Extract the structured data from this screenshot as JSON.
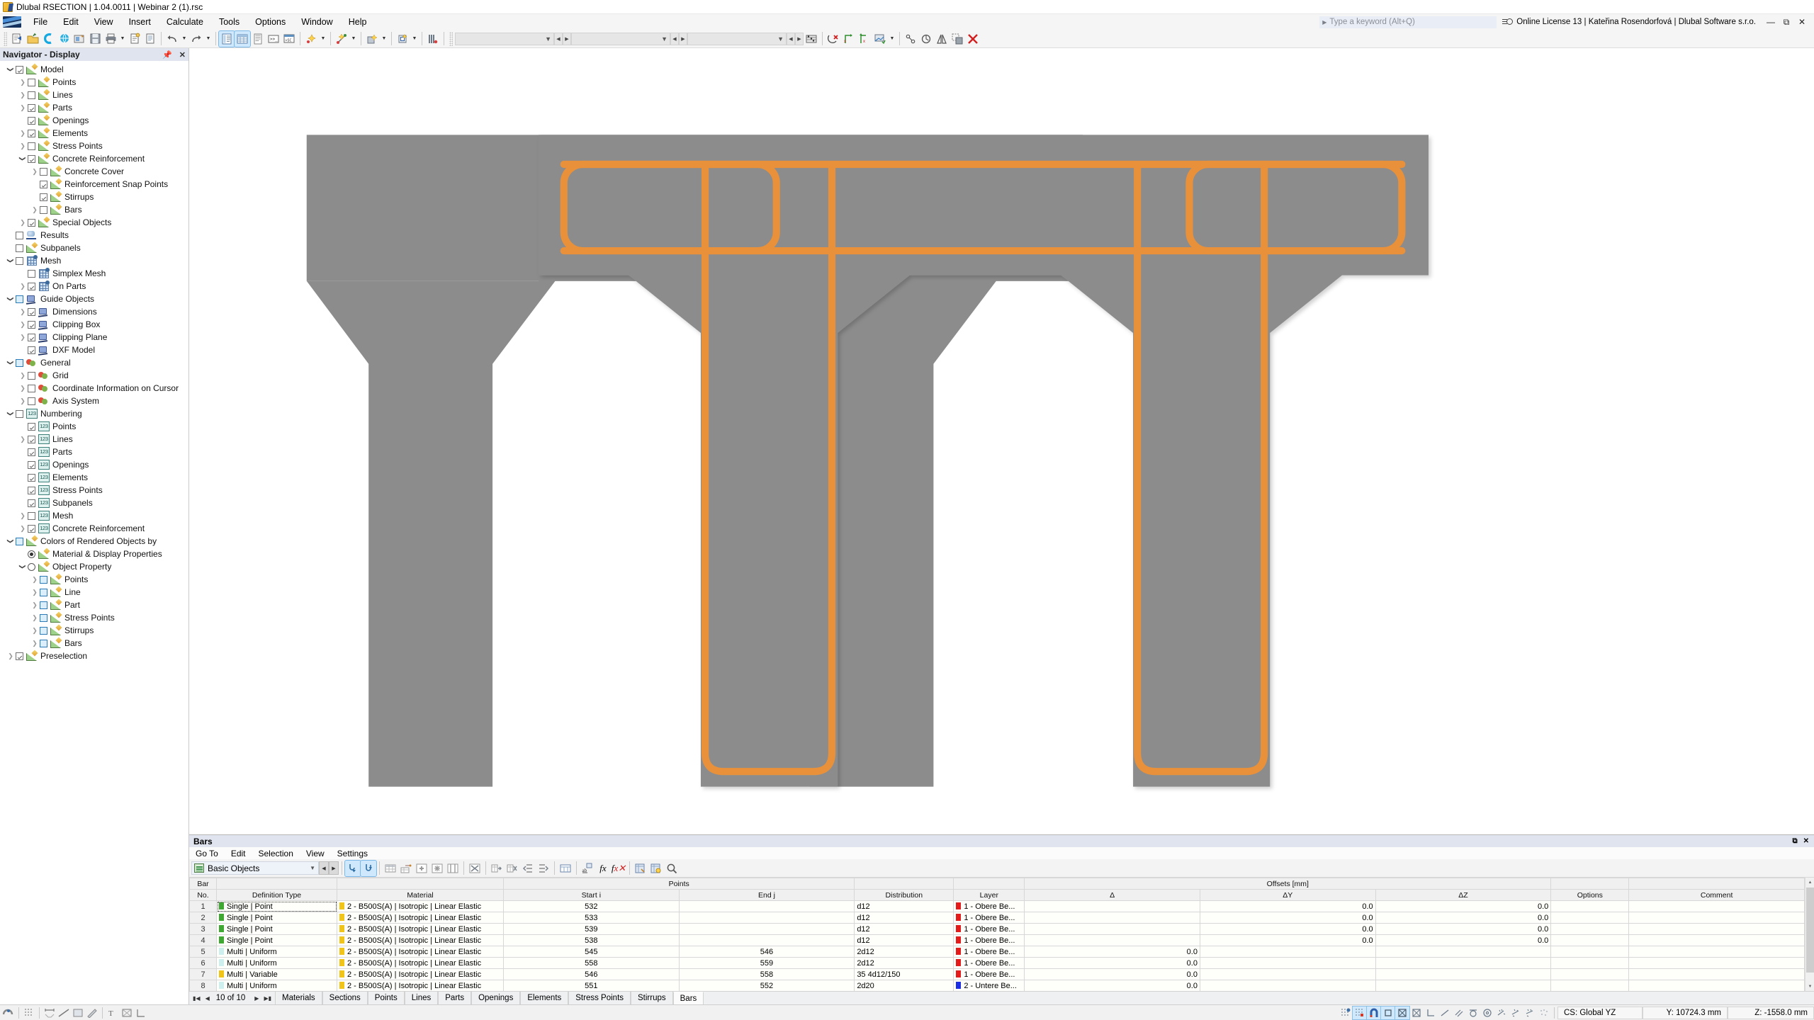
{
  "titlebar": {
    "title": "Dlubal RSECTION | 1.04.0011 | Webinar 2 (1).rsc",
    "icon": "dlubal-logo-icon"
  },
  "menubar": {
    "items": [
      "File",
      "Edit",
      "View",
      "Insert",
      "Calculate",
      "Tools",
      "Options",
      "Window",
      "Help"
    ],
    "search_placeholder": "Type a keyword (Alt+Q)",
    "license": "Online License 13 | Kateřina Rosendorfová | Dlubal Software s.r.o.",
    "window_buttons": [
      "minimize",
      "restore",
      "close"
    ]
  },
  "navigator": {
    "title": "Navigator - Display",
    "pin_icon": "pin-icon",
    "close_icon": "close-icon",
    "items": [
      {
        "label": "Model",
        "indent": 0,
        "expander": "down",
        "check": "checked",
        "icon": "ruler-icon"
      },
      {
        "label": "Points",
        "indent": 1,
        "expander": "right",
        "check": "unchecked",
        "icon": "ruler-icon"
      },
      {
        "label": "Lines",
        "indent": 1,
        "expander": "right",
        "check": "unchecked",
        "icon": "ruler-icon"
      },
      {
        "label": "Parts",
        "indent": 1,
        "expander": "right",
        "check": "checked",
        "icon": "ruler-icon"
      },
      {
        "label": "Openings",
        "indent": 1,
        "expander": "none",
        "check": "checked",
        "icon": "ruler-icon"
      },
      {
        "label": "Elements",
        "indent": 1,
        "expander": "right",
        "check": "checked",
        "icon": "ruler-icon"
      },
      {
        "label": "Stress Points",
        "indent": 1,
        "expander": "right",
        "check": "unchecked",
        "icon": "ruler-icon"
      },
      {
        "label": "Concrete Reinforcement",
        "indent": 1,
        "expander": "down",
        "check": "checked",
        "icon": "ruler-icon"
      },
      {
        "label": "Concrete Cover",
        "indent": 2,
        "expander": "right",
        "check": "unchecked",
        "icon": "ruler-icon"
      },
      {
        "label": "Reinforcement Snap Points",
        "indent": 2,
        "expander": "none",
        "check": "checked",
        "icon": "ruler-icon"
      },
      {
        "label": "Stirrups",
        "indent": 2,
        "expander": "none",
        "check": "checked",
        "icon": "ruler-icon"
      },
      {
        "label": "Bars",
        "indent": 2,
        "expander": "right",
        "check": "unchecked",
        "icon": "ruler-icon"
      },
      {
        "label": "Special Objects",
        "indent": 1,
        "expander": "right",
        "check": "checked",
        "icon": "ruler-icon"
      },
      {
        "label": "Results",
        "indent": 0,
        "expander": "none",
        "check": "unchecked",
        "icon": "results-icon"
      },
      {
        "label": "Subpanels",
        "indent": 0,
        "expander": "none",
        "check": "unchecked",
        "icon": "ruler-icon"
      },
      {
        "label": "Mesh",
        "indent": 0,
        "expander": "down",
        "check": "unchecked",
        "icon": "mesh-icon"
      },
      {
        "label": "Simplex Mesh",
        "indent": 1,
        "expander": "none",
        "check": "unchecked",
        "icon": "mesh-icon"
      },
      {
        "label": "On Parts",
        "indent": 1,
        "expander": "right",
        "check": "checked",
        "icon": "mesh-icon"
      },
      {
        "label": "Guide Objects",
        "indent": 0,
        "expander": "down",
        "check": "blue",
        "icon": "guide-icon"
      },
      {
        "label": "Dimensions",
        "indent": 1,
        "expander": "right",
        "check": "checked",
        "icon": "guide-icon"
      },
      {
        "label": "Clipping Box",
        "indent": 1,
        "expander": "right",
        "check": "checked",
        "icon": "guide-icon"
      },
      {
        "label": "Clipping Plane",
        "indent": 1,
        "expander": "right",
        "check": "checked",
        "icon": "guide-icon"
      },
      {
        "label": "DXF Model",
        "indent": 1,
        "expander": "none",
        "check": "checked",
        "icon": "guide-icon"
      },
      {
        "label": "General",
        "indent": 0,
        "expander": "down",
        "check": "blue",
        "icon": "general-icon"
      },
      {
        "label": "Grid",
        "indent": 1,
        "expander": "right",
        "check": "unchecked",
        "icon": "general-icon"
      },
      {
        "label": "Coordinate Information on Cursor",
        "indent": 1,
        "expander": "right",
        "check": "unchecked",
        "icon": "general-icon"
      },
      {
        "label": "Axis System",
        "indent": 1,
        "expander": "right",
        "check": "unchecked",
        "icon": "general-icon"
      },
      {
        "label": "Numbering",
        "indent": 0,
        "expander": "down",
        "check": "unchecked",
        "icon": "numbering-icon"
      },
      {
        "label": "Points",
        "indent": 1,
        "expander": "none",
        "check": "checked",
        "icon": "numbering-icon"
      },
      {
        "label": "Lines",
        "indent": 1,
        "expander": "right",
        "check": "checked",
        "icon": "numbering-icon"
      },
      {
        "label": "Parts",
        "indent": 1,
        "expander": "none",
        "check": "checked",
        "icon": "numbering-icon"
      },
      {
        "label": "Openings",
        "indent": 1,
        "expander": "none",
        "check": "checked",
        "icon": "numbering-icon"
      },
      {
        "label": "Elements",
        "indent": 1,
        "expander": "none",
        "check": "checked",
        "icon": "numbering-icon"
      },
      {
        "label": "Stress Points",
        "indent": 1,
        "expander": "none",
        "check": "checked",
        "icon": "numbering-icon"
      },
      {
        "label": "Subpanels",
        "indent": 1,
        "expander": "none",
        "check": "checked",
        "icon": "numbering-icon"
      },
      {
        "label": "Mesh",
        "indent": 1,
        "expander": "right",
        "check": "unchecked",
        "icon": "numbering-icon"
      },
      {
        "label": "Concrete Reinforcement",
        "indent": 1,
        "expander": "right",
        "check": "checked",
        "icon": "numbering-icon"
      },
      {
        "label": "Colors of Rendered Objects by",
        "indent": 0,
        "expander": "down",
        "check": "blue",
        "icon": "ruler-icon"
      },
      {
        "label": "Material & Display Properties",
        "indent": 1,
        "expander": "none",
        "check": "radio-selected",
        "icon": "ruler-icon"
      },
      {
        "label": "Object Property",
        "indent": 1,
        "expander": "down",
        "check": "radio",
        "icon": "ruler-icon"
      },
      {
        "label": "Points",
        "indent": 2,
        "expander": "right",
        "check": "blue",
        "icon": "ruler-icon"
      },
      {
        "label": "Line",
        "indent": 2,
        "expander": "right",
        "check": "blue",
        "icon": "ruler-icon"
      },
      {
        "label": "Part",
        "indent": 2,
        "expander": "right",
        "check": "blue",
        "icon": "ruler-icon"
      },
      {
        "label": "Stress Points",
        "indent": 2,
        "expander": "right",
        "check": "blue",
        "icon": "ruler-icon"
      },
      {
        "label": "Stirrups",
        "indent": 2,
        "expander": "right",
        "check": "blue",
        "icon": "ruler-icon"
      },
      {
        "label": "Bars",
        "indent": 2,
        "expander": "right",
        "check": "blue",
        "icon": "ruler-icon"
      },
      {
        "label": "Preselection",
        "indent": 0,
        "expander": "right",
        "check": "checked",
        "icon": "ruler-icon"
      }
    ]
  },
  "viewport": {
    "concrete_color": "#8c8c8c",
    "rebar_color": "#e8913a",
    "background": "#ffffff"
  },
  "table_panel": {
    "title": "Bars",
    "menu": [
      "Go To",
      "Edit",
      "Selection",
      "View",
      "Settings"
    ],
    "object_filter": "Basic Objects",
    "headers_top": {
      "points": "Points",
      "offsets": "Offsets [mm]"
    },
    "columns": [
      "Bar No.",
      "Definition Type",
      "Material",
      "Start i",
      "End j",
      "Distribution",
      "Layer",
      "Δ",
      "ΔY",
      "ΔZ",
      "Options",
      "Comment"
    ],
    "rows": [
      {
        "no": "1",
        "def_type": "Single | Point",
        "def_color": "#3ea832",
        "material": "2 - B500S(A) | Isotropic | Linear Elastic",
        "mat_color": "#f0c419",
        "start": "532",
        "end": "",
        "distribution": "d12",
        "layer": "1 - Obere Be...",
        "layer_color": "#e31b1b",
        "delta": "",
        "dy": "0.0",
        "dz": "0.0",
        "options": "",
        "comment": ""
      },
      {
        "no": "2",
        "def_type": "Single | Point",
        "def_color": "#3ea832",
        "material": "2 - B500S(A) | Isotropic | Linear Elastic",
        "mat_color": "#f0c419",
        "start": "533",
        "end": "",
        "distribution": "d12",
        "layer": "1 - Obere Be...",
        "layer_color": "#e31b1b",
        "delta": "",
        "dy": "0.0",
        "dz": "0.0",
        "options": "",
        "comment": ""
      },
      {
        "no": "3",
        "def_type": "Single | Point",
        "def_color": "#3ea832",
        "material": "2 - B500S(A) | Isotropic | Linear Elastic",
        "mat_color": "#f0c419",
        "start": "539",
        "end": "",
        "distribution": "d12",
        "layer": "1 - Obere Be...",
        "layer_color": "#e31b1b",
        "delta": "",
        "dy": "0.0",
        "dz": "0.0",
        "options": "",
        "comment": ""
      },
      {
        "no": "4",
        "def_type": "Single | Point",
        "def_color": "#3ea832",
        "material": "2 - B500S(A) | Isotropic | Linear Elastic",
        "mat_color": "#f0c419",
        "start": "538",
        "end": "",
        "distribution": "d12",
        "layer": "1 - Obere Be...",
        "layer_color": "#e31b1b",
        "delta": "",
        "dy": "0.0",
        "dz": "0.0",
        "options": "",
        "comment": ""
      },
      {
        "no": "5",
        "def_type": "Multi | Uniform",
        "def_color": "#cdf0ee",
        "material": "2 - B500S(A) | Isotropic | Linear Elastic",
        "mat_color": "#f0c419",
        "start": "545",
        "end": "546",
        "distribution": "2d12",
        "layer": "1 - Obere Be...",
        "layer_color": "#e31b1b",
        "delta": "0.0",
        "dy": "",
        "dz": "",
        "options": "",
        "comment": ""
      },
      {
        "no": "6",
        "def_type": "Multi | Uniform",
        "def_color": "#cdf0ee",
        "material": "2 - B500S(A) | Isotropic | Linear Elastic",
        "mat_color": "#f0c419",
        "start": "558",
        "end": "559",
        "distribution": "2d12",
        "layer": "1 - Obere Be...",
        "layer_color": "#e31b1b",
        "delta": "0.0",
        "dy": "",
        "dz": "",
        "options": "",
        "comment": ""
      },
      {
        "no": "7",
        "def_type": "Multi | Variable",
        "def_color": "#f0c419",
        "material": "2 - B500S(A) | Isotropic | Linear Elastic",
        "mat_color": "#f0c419",
        "start": "546",
        "end": "558",
        "distribution": "35 4d12/150",
        "layer": "1 - Obere Be...",
        "layer_color": "#e31b1b",
        "delta": "0.0",
        "dy": "",
        "dz": "",
        "options": "",
        "comment": ""
      },
      {
        "no": "8",
        "def_type": "Multi | Uniform",
        "def_color": "#cdf0ee",
        "material": "2 - B500S(A) | Isotropic | Linear Elastic",
        "mat_color": "#f0c419",
        "start": "551",
        "end": "552",
        "distribution": "2d20",
        "layer": "2 - Untere Be...",
        "layer_color": "#1b2ee3",
        "delta": "0.0",
        "dy": "",
        "dz": "",
        "options": "",
        "comment": ""
      }
    ],
    "record_info": "10 of 10",
    "tabs": [
      "Materials",
      "Sections",
      "Points",
      "Lines",
      "Parts",
      "Openings",
      "Elements",
      "Stress Points",
      "Stirrups",
      "Bars"
    ],
    "active_tab": "Bars"
  },
  "statusbar": {
    "cs": "CS: Global YZ",
    "coord_y": "Y: 10724.3 mm",
    "coord_z": "Z: -1558.0 mm"
  }
}
